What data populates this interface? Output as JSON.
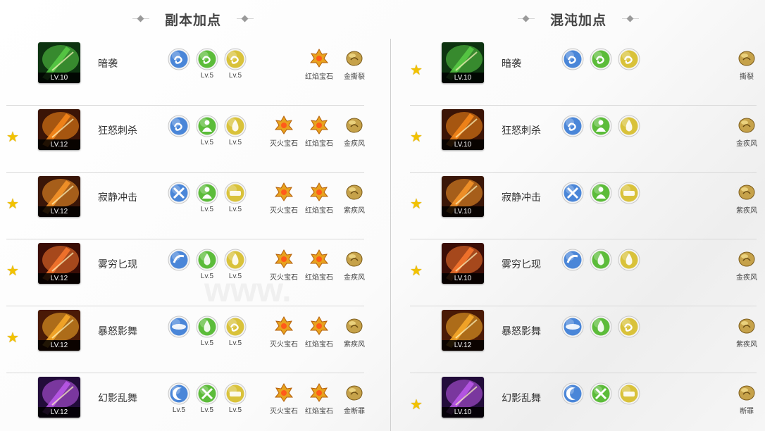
{
  "left": {
    "title": "副本加点",
    "rows": [
      {
        "star": false,
        "name": "暗袭",
        "level": "LV.10",
        "runes": [
          {
            "lv": ""
          },
          {
            "lv": "Lv.5"
          },
          {
            "lv": "Lv.5"
          }
        ],
        "gems": [
          "",
          "红焰宝石",
          "金撕裂"
        ]
      },
      {
        "star": true,
        "name": "狂怒刺杀",
        "level": "LV.12",
        "runes": [
          {
            "lv": ""
          },
          {
            "lv": "Lv.5"
          },
          {
            "lv": "Lv.5"
          }
        ],
        "gems": [
          "灭火宝石",
          "红焰宝石",
          "金疾风"
        ]
      },
      {
        "star": true,
        "name": "寂静冲击",
        "level": "LV.12",
        "runes": [
          {
            "lv": ""
          },
          {
            "lv": "Lv.5"
          },
          {
            "lv": "Lv.5"
          }
        ],
        "gems": [
          "灭火宝石",
          "红焰宝石",
          "紫疾风"
        ]
      },
      {
        "star": true,
        "name": "雾穷匕现",
        "level": "LV.12",
        "runes": [
          {
            "lv": ""
          },
          {
            "lv": "Lv.5"
          },
          {
            "lv": "Lv.5"
          }
        ],
        "gems": [
          "灭火宝石",
          "红焰宝石",
          "金疾风"
        ]
      },
      {
        "star": true,
        "name": "暴怒影舞",
        "level": "LV.12",
        "runes": [
          {
            "lv": ""
          },
          {
            "lv": "Lv.5"
          },
          {
            "lv": "Lv.5"
          }
        ],
        "gems": [
          "灭火宝石",
          "红焰宝石",
          "紫疾风"
        ]
      },
      {
        "star": false,
        "name": "幻影乱舞",
        "level": "LV.12",
        "runes": [
          {
            "lv": "Lv.5"
          },
          {
            "lv": "Lv.5"
          },
          {
            "lv": "Lv.5"
          }
        ],
        "gems": [
          "灭火宝石",
          "红焰宝石",
          "金断罪"
        ]
      }
    ]
  },
  "right": {
    "title": "混沌加点",
    "rows": [
      {
        "star": true,
        "name": "暗袭",
        "level": "LV.10",
        "gem": "撕裂"
      },
      {
        "star": true,
        "name": "狂怒刺杀",
        "level": "LV.10",
        "gem": "金疾风"
      },
      {
        "star": true,
        "name": "寂静冲击",
        "level": "LV.10",
        "gem": "紫疾风"
      },
      {
        "star": true,
        "name": "雾穷匕现",
        "level": "LV.10",
        "gem": "金疾风"
      },
      {
        "star": false,
        "name": "暴怒影舞",
        "level": "LV.12",
        "gem": "紫疾风"
      },
      {
        "star": true,
        "name": "幻影乱舞",
        "level": "LV.10",
        "gem": "断罪"
      }
    ]
  },
  "colors": {
    "star": "#f2c200",
    "rune_blue": "#4a86d8",
    "rune_green": "#5cbc3a",
    "rune_yellow": "#d9c23a"
  },
  "watermark": "www."
}
